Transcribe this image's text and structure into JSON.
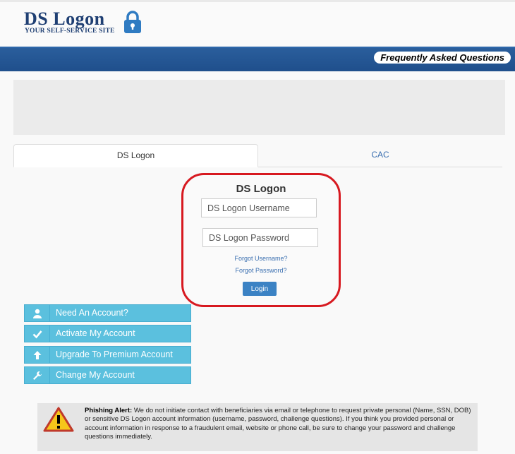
{
  "header": {
    "logo_title": "DS Logon",
    "logo_subtitle": "YOUR SELF-SERVICE SITE",
    "logo_icon": "padlock-icon"
  },
  "nav": {
    "faq_label": "Frequently Asked Questions"
  },
  "tabs": [
    {
      "label": "DS Logon",
      "active": true
    },
    {
      "label": "CAC",
      "active": false
    }
  ],
  "login": {
    "title": "DS Logon",
    "username_placeholder": "DS Logon Username",
    "password_placeholder": "DS Logon Password",
    "forgot_username": "Forgot Username?",
    "forgot_password": "Forgot Password?",
    "login_button": "Login"
  },
  "account_buttons": [
    {
      "label": "Need An Account?",
      "icon": "user-icon"
    },
    {
      "label": "Activate My Account",
      "icon": "checkmark-icon"
    },
    {
      "label": "Upgrade To Premium Account",
      "icon": "arrow-up-icon"
    },
    {
      "label": "Change My Account",
      "icon": "wrench-icon"
    }
  ],
  "phishing_alert": {
    "heading": "Phishing Alert:",
    "body": "We do not initiate contact with beneficiaries via email or telephone to request private personal (Name, SSN, DOB) or sensitive DS Logon account information (username, password, challenge questions). If you think you provided personal or account information in response to a fraudulent email, website or phone call, be sure to change your password and challenge questions immediately.",
    "icon": "warning-icon"
  },
  "colors": {
    "navbar": "#1f4f8c",
    "logo_text": "#1f3f73",
    "highlight_ring": "#d71920",
    "account_button": "#5bc0de",
    "login_button": "#3b82c4",
    "link": "#3a6fb0"
  }
}
